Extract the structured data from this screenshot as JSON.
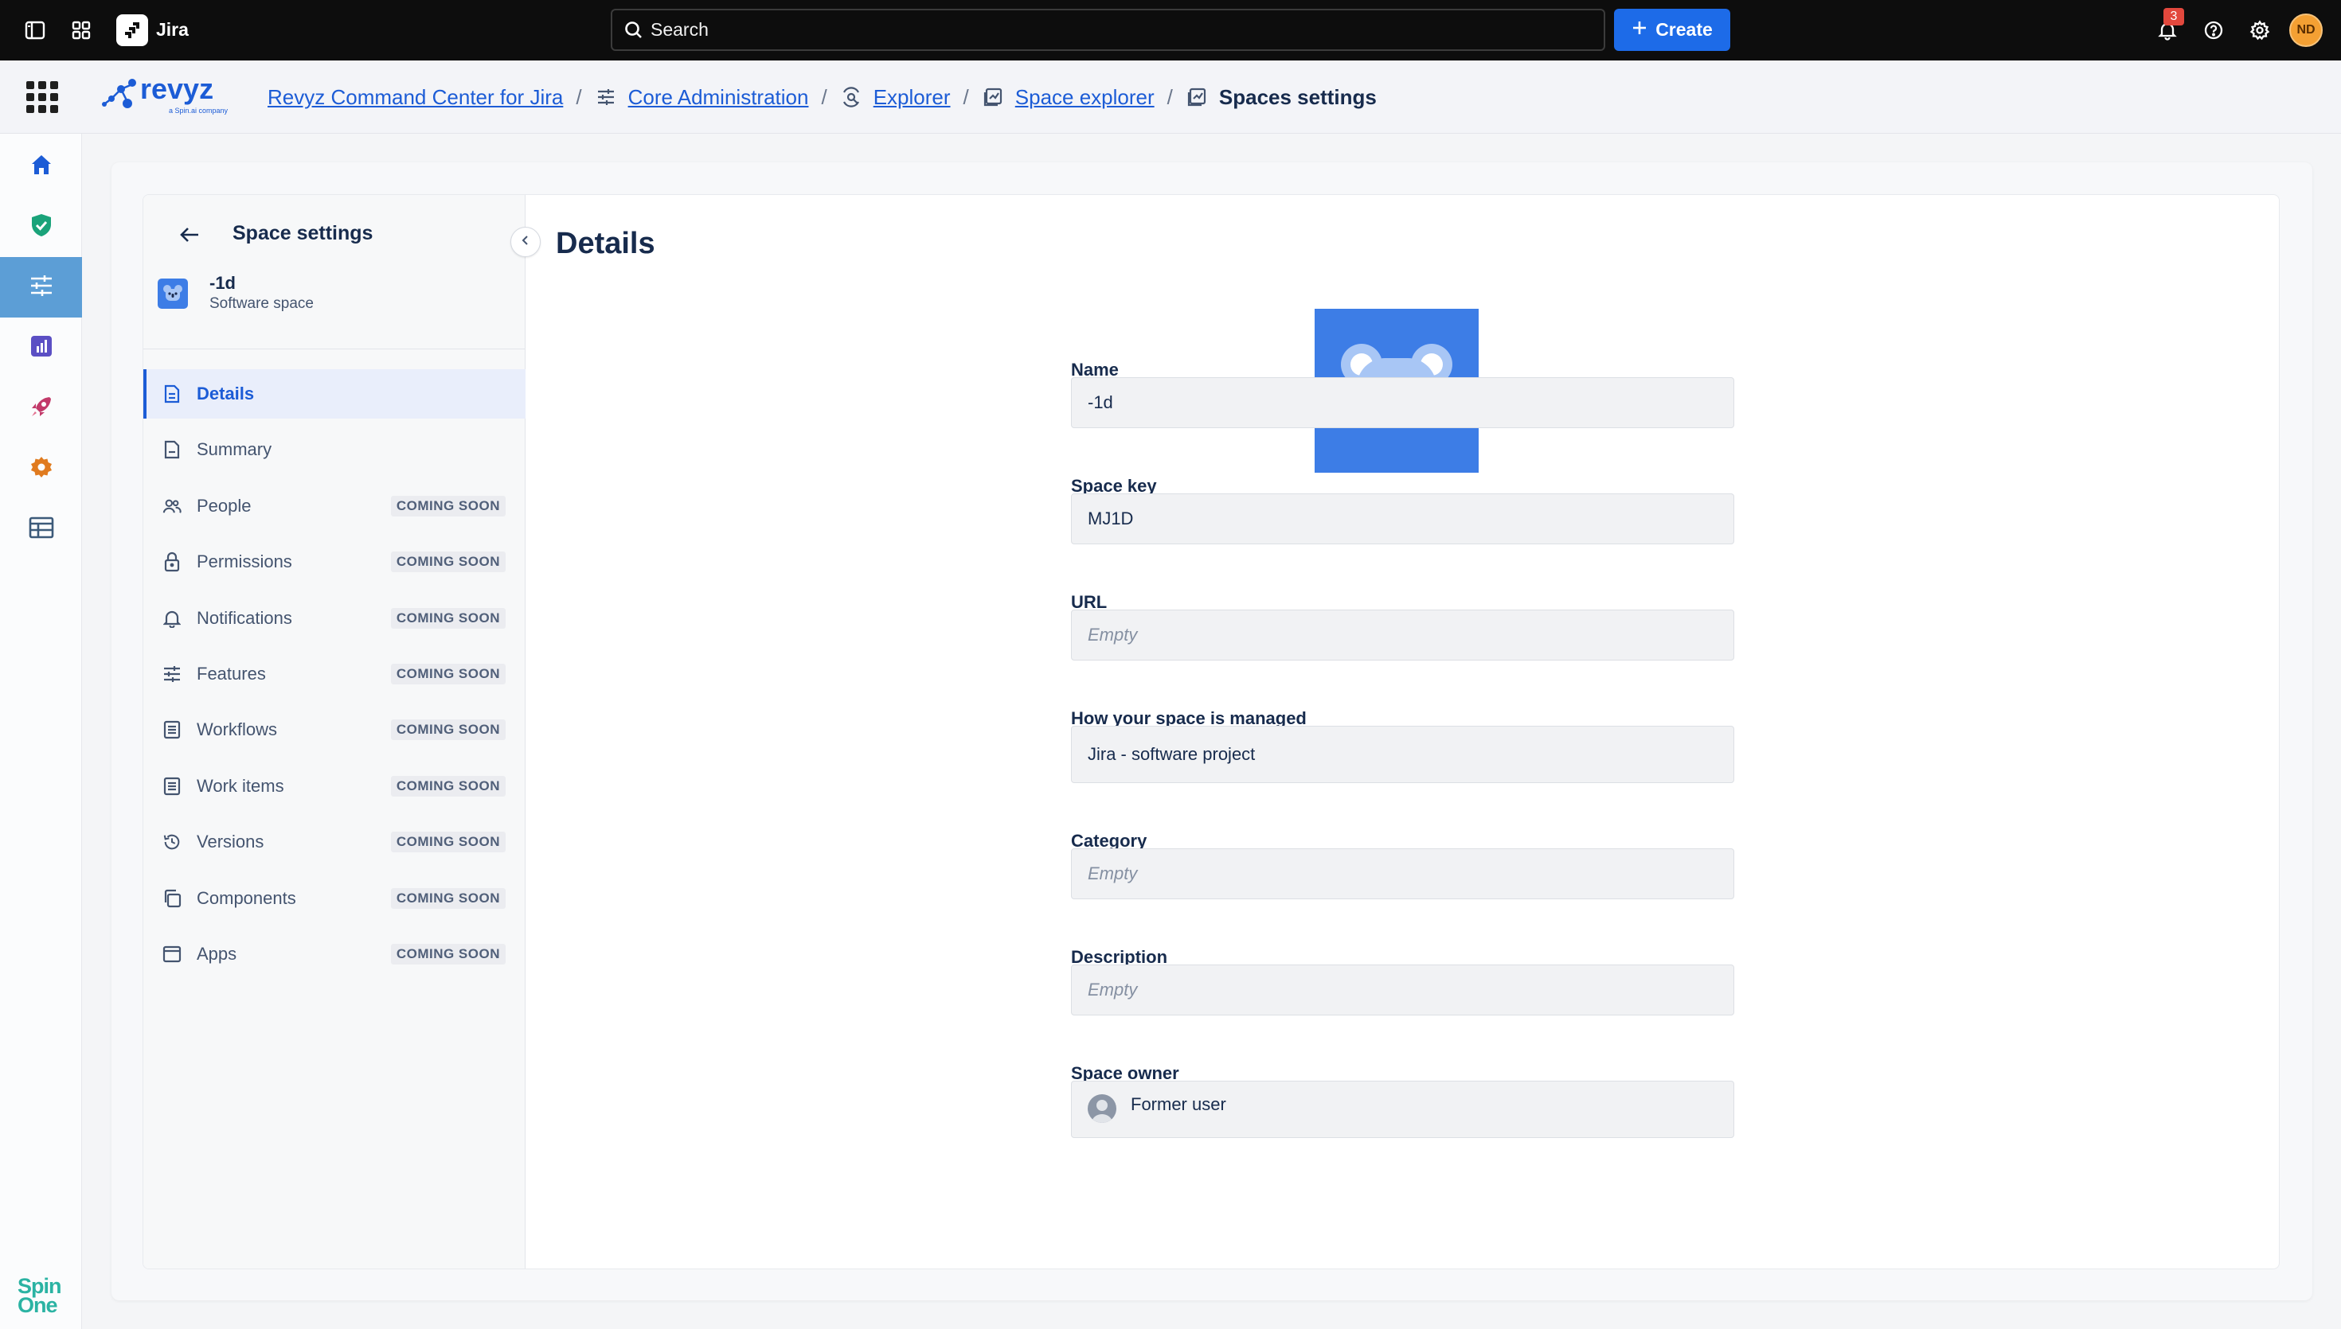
{
  "topbar": {
    "app_name": "Jira",
    "search_placeholder": "Search",
    "create_label": "Create",
    "notification_count": "3",
    "user_initials": "ND"
  },
  "breadcrumb": {
    "items": [
      {
        "label": "Revyz Command Center for Jira",
        "icon": "none"
      },
      {
        "label": "Core Administration",
        "icon": "sliders-icon"
      },
      {
        "label": "Explorer",
        "icon": "explorer-icon"
      },
      {
        "label": "Space explorer",
        "icon": "space-explorer-icon"
      }
    ],
    "current": "Spaces settings",
    "separator": "/"
  },
  "brand": {
    "logo_text": "revyz",
    "logo_sub": "a Spin.ai company",
    "footer_logo_line1": "Spin",
    "footer_logo_line2": "One"
  },
  "sidenav": {
    "title": "Space settings",
    "space_name": "-1d",
    "space_type": "Software space",
    "items": [
      {
        "label": "Details",
        "icon": "document-icon",
        "badge": ""
      },
      {
        "label": "Summary",
        "icon": "summary-icon",
        "badge": ""
      },
      {
        "label": "People",
        "icon": "people-icon",
        "badge": "COMING SOON"
      },
      {
        "label": "Permissions",
        "icon": "lock-icon",
        "badge": "COMING SOON"
      },
      {
        "label": "Notifications",
        "icon": "bell-icon",
        "badge": "COMING SOON"
      },
      {
        "label": "Features",
        "icon": "sliders-icon",
        "badge": "COMING SOON"
      },
      {
        "label": "Workflows",
        "icon": "list-icon",
        "badge": "COMING SOON"
      },
      {
        "label": "Work items",
        "icon": "list-icon",
        "badge": "COMING SOON"
      },
      {
        "label": "Versions",
        "icon": "history-icon",
        "badge": "COMING SOON"
      },
      {
        "label": "Components",
        "icon": "components-icon",
        "badge": "COMING SOON"
      },
      {
        "label": "Apps",
        "icon": "window-icon",
        "badge": "COMING SOON"
      }
    ]
  },
  "details": {
    "title": "Details",
    "fields": {
      "name": {
        "label": "Name",
        "value": "-1d"
      },
      "space_key": {
        "label": "Space key",
        "value": "MJ1D"
      },
      "url": {
        "label": "URL",
        "value": "Empty"
      },
      "managed": {
        "label": "How your space is managed",
        "value": "Jira - software project"
      },
      "category": {
        "label": "Category",
        "value": "Empty"
      },
      "description": {
        "label": "Description",
        "value": "Empty"
      },
      "owner": {
        "label": "Space owner",
        "value": "Former user"
      }
    }
  },
  "colors": {
    "accent": "#1c5cd6",
    "create_button": "#1d6be8",
    "rail_active": "#5c9ed6",
    "space_avatar": "#3d7de6",
    "notification_badge": "#e2483d"
  }
}
